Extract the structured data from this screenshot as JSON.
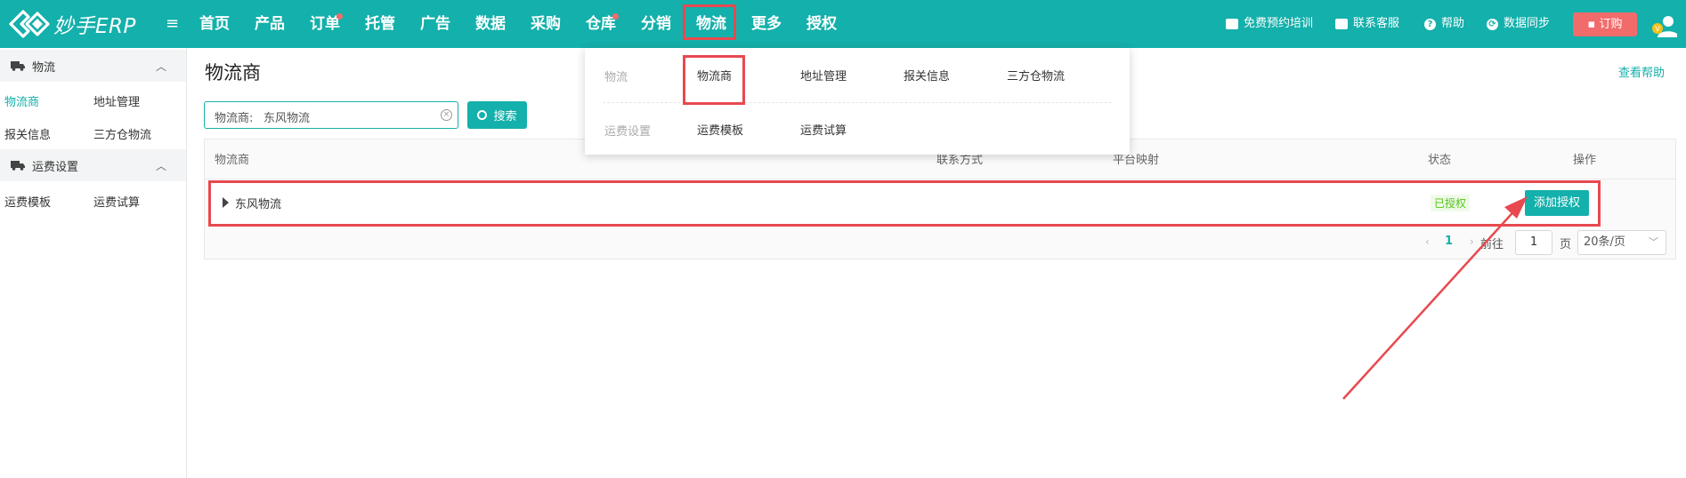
{
  "brand": {
    "name": "妙手ERP"
  },
  "top_nav": {
    "items": [
      "首页",
      "产品",
      "订单",
      "托管",
      "广告",
      "数据",
      "采购",
      "仓库",
      "分销",
      "物流",
      "更多",
      "授权"
    ],
    "active": "物流"
  },
  "top_right": {
    "training": "免费预约培训",
    "support": "联系客服",
    "help": "帮助",
    "sync": "数据同步",
    "order": "订购"
  },
  "sidebar": {
    "groups": [
      {
        "title": "物流",
        "links": [
          "物流商",
          "地址管理",
          "报关信息",
          "三方仓物流"
        ]
      },
      {
        "title": "运费设置",
        "links": [
          "运费模板",
          "运费试算"
        ]
      }
    ],
    "active_link": "物流商"
  },
  "page": {
    "title": "物流商",
    "help_link": "查看帮助"
  },
  "search": {
    "label": "物流商:",
    "value": "东风物流",
    "button": "搜索"
  },
  "table": {
    "columns": [
      "物流商",
      "联系方式",
      "平台映射",
      "状态",
      "操作"
    ],
    "rows": [
      {
        "name": "东风物流",
        "status": "已授权",
        "action": "添加授权"
      }
    ]
  },
  "pagination": {
    "current_page": "1",
    "goto_label": "前往",
    "goto_value": "1",
    "page_unit": "页",
    "page_size": "20条/页"
  },
  "dropdown": {
    "sections": [
      {
        "category": "物流",
        "items": [
          "物流商",
          "地址管理",
          "报关信息",
          "三方仓物流"
        ]
      },
      {
        "category": "运费设置",
        "items": [
          "运费模板",
          "运费试算"
        ]
      }
    ],
    "active_item": "物流商"
  },
  "colors": {
    "primary": "#14b0ab",
    "highlight": "#e8494f",
    "success": "#52c41a",
    "order_button": "#f26b6b"
  }
}
